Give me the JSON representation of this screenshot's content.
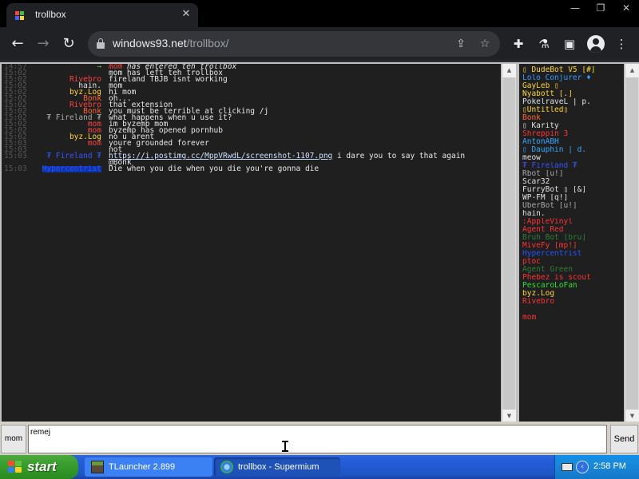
{
  "browser": {
    "tab_title": "trollbox",
    "tab_close": "✕",
    "win_minimize": "—",
    "win_restore": "❐",
    "win_close": "✕",
    "url_host": "windows93.net",
    "url_path": "/trollbox/",
    "icons": [
      "back-icon",
      "forward-icon",
      "reload-icon",
      "lock-icon",
      "share-icon",
      "star-icon",
      "extensions-icon",
      "flask-icon",
      "sidepanel-icon",
      "profile-icon",
      "menu-icon"
    ]
  },
  "chat": {
    "messages": [
      {
        "time": "14:57",
        "user": "→",
        "user_color": "#3ec43e",
        "text": "",
        "join_user": "mom",
        "join_color": "#ff4040",
        "join_text": " has entered teh trollbox",
        "italic": true
      },
      {
        "time": "15:02",
        "user": "",
        "user_color": "#e0e0e0",
        "text": "mom has left teh trollbox"
      },
      {
        "time": "15:02",
        "user": "Rivebro",
        "user_color": "#ff4040",
        "text": "fireland TBJB isnt working"
      },
      {
        "time": "15:02",
        "user": "hain.",
        "user_color": "#e0e0e0",
        "text": "mom"
      },
      {
        "time": "15:02",
        "user": "byz.Log",
        "user_color": "#ffd633",
        "text": "hi mom"
      },
      {
        "time": "15:02",
        "user": "Bonk",
        "user_color": "#ff6633",
        "text": "oh..."
      },
      {
        "time": "15:02",
        "user": "Rivebro",
        "user_color": "#ff4040",
        "text": "that extension"
      },
      {
        "time": "15:02",
        "user": "Bonk",
        "user_color": "#ff6633",
        "text": "you must be terrible at clicking   /j"
      },
      {
        "time": "15:02",
        "user": "₮ Fireland ₮",
        "user_color": "#aaaaaa",
        "text": "what happens when u use it?"
      },
      {
        "time": "15:02",
        "user": "mom",
        "user_color": "#ff4040",
        "text": "im byzemp mom"
      },
      {
        "time": "15:02",
        "user": "mom",
        "user_color": "#ff4040",
        "text": "byzemp has opened pornhub"
      },
      {
        "time": "15:02",
        "user": "byz.Log",
        "user_color": "#ffd633",
        "text": "no u arent"
      },
      {
        "time": "15:03",
        "user": "mom",
        "user_color": "#ff4040",
        "text": "youre grounded forever"
      },
      {
        "time": "15:03",
        "user": "",
        "user_color": "#e0e0e0",
        "text": "not"
      },
      {
        "time": "15:03",
        "user": "₮ Fireland ₮",
        "user_color": "#3355ff",
        "link": "https://i.postimg.cc/MppVRwdL/screenshot-1107.png",
        "text": " i dare you to say that again"
      },
      {
        "time": "",
        "user": "",
        "user_color": "#e0e0e0",
        "text": "@Bonk"
      },
      {
        "time": "15:03",
        "user": "Hypercentrist",
        "user_color": "#2255ff",
        "user_bg": "#1133aa",
        "text": "Die when you die when you die you're gonna die"
      }
    ],
    "users": [
      {
        "name": "▯ DudeBot V5 [#]",
        "color": "#ffd633"
      },
      {
        "name": "Lolo Conjurer ♦",
        "color": "#3399ff"
      },
      {
        "name": "GayLeb ▯",
        "color": "#ffd633"
      },
      {
        "name": "Nyabott [.]",
        "color": "#ffd633"
      },
      {
        "name": "PokelraveL | p.",
        "color": "#e0e0e0"
      },
      {
        "name": "▯Untitled▯",
        "color": "#ffd633"
      },
      {
        "name": "Bonk",
        "color": "#ff6633"
      },
      {
        "name": "▯ Karity",
        "color": "#e0e0e0"
      },
      {
        "name": "Shreppin 3",
        "color": "#ff3333"
      },
      {
        "name": "AntonABH",
        "color": "#33aaff"
      },
      {
        "name": "▯ Dauphin | d.",
        "color": "#33aaff"
      },
      {
        "name": "meow",
        "color": "#e0e0e0"
      },
      {
        "name": "₮ Fireland ₮",
        "color": "#3355ff"
      },
      {
        "name": "Rbot [u!]",
        "color": "#aaaaaa"
      },
      {
        "name": "Scar32",
        "color": "#e0e0e0"
      },
      {
        "name": "FurryBot ▯ [&]",
        "color": "#e0e0e0"
      },
      {
        "name": "WP-FM [q!]",
        "color": "#e0e0e0"
      },
      {
        "name": "UberBot [u!]",
        "color": "#aaaaaa"
      },
      {
        "name": "hain.",
        "color": "#e0e0e0"
      },
      {
        "name": ":AppleVinyl",
        "color": "#ff3333"
      },
      {
        "name": "Agent Red",
        "color": "#ff3333"
      },
      {
        "name": "Bruh Bot [bru]",
        "color": "#2e7d32"
      },
      {
        "name": "MiveFy [mp!]",
        "color": "#ff3333"
      },
      {
        "name": "Hypercentrist",
        "color": "#2255ff"
      },
      {
        "name": "ptoc",
        "color": "#ff3333"
      },
      {
        "name": "Agent Green",
        "color": "#2e7d32"
      },
      {
        "name": "Phebez is scout",
        "color": "#ff3333"
      },
      {
        "name": "PescaroLoFan",
        "color": "#33dd33"
      },
      {
        "name": "byz.Log",
        "color": "#ffd633"
      },
      {
        "name": "Rivebro",
        "color": "#ff3333"
      },
      {
        "name": "",
        "color": "#e0e0e0"
      },
      {
        "name": "mom",
        "color": "#ff3333"
      }
    ],
    "nick_label": "mom",
    "input_value": "remej",
    "send_label": "Send"
  },
  "taskbar": {
    "start_label": "start",
    "tasks": [
      {
        "label": "TLauncher 2.899",
        "icon": "minecraft-icon"
      },
      {
        "label": "trollbox - Supermium",
        "icon": "supermium-icon"
      }
    ],
    "clock": "2:58 PM"
  }
}
